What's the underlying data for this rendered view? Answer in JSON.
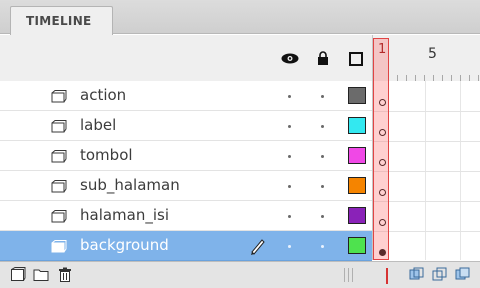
{
  "panel": {
    "tab_label": "TIMELINE"
  },
  "header": {
    "frame_numbers": [
      "1",
      "5"
    ]
  },
  "layers": [
    {
      "name": "action",
      "color": "#6b6b6b",
      "selected": false,
      "keyframe": "empty"
    },
    {
      "name": "label",
      "color": "#33e8f0",
      "selected": false,
      "keyframe": "empty"
    },
    {
      "name": "tombol",
      "color": "#f048e6",
      "selected": false,
      "keyframe": "empty"
    },
    {
      "name": "sub_halaman",
      "color": "#f58400",
      "selected": false,
      "keyframe": "empty"
    },
    {
      "name": "halaman_isi",
      "color": "#8a22b8",
      "selected": false,
      "keyframe": "empty"
    },
    {
      "name": "background",
      "color": "#4ee24e",
      "selected": true,
      "keyframe": "filled"
    }
  ],
  "icons": {
    "visibility": "eye-icon",
    "lock": "lock-icon",
    "outline": "outline-icon",
    "edit": "pencil-icon",
    "new_layer": "new-layer-icon",
    "new_folder": "new-folder-icon",
    "delete": "trash-icon"
  },
  "colors": {
    "selection": "#7fb3ea",
    "playhead": "#e04444"
  }
}
